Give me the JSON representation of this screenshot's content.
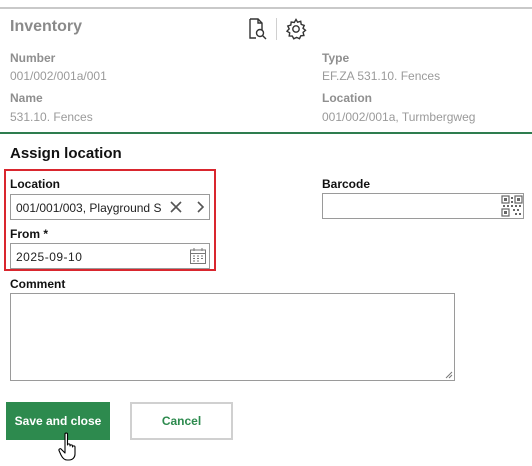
{
  "inventory": {
    "title": "Inventory",
    "number_label": "Number",
    "number_value": "001/002/001a/001",
    "type_label": "Type",
    "type_value": "EF.ZA 531.10. Fences",
    "name_label": "Name",
    "name_value": "531.10. Fences",
    "location_label": "Location",
    "location_value": "001/002/001a, Turmbergweg",
    "icons": [
      "document-search-icon",
      "gear-icon"
    ]
  },
  "assign": {
    "title": "Assign location",
    "location_label": "Location",
    "location_value": "001/001/003, Playground S",
    "from_label": "From *",
    "from_value": "2025-09-10",
    "barcode_label": "Barcode",
    "barcode_value": "",
    "comment_label": "Comment",
    "comment_value": ""
  },
  "actions": {
    "save_label": "Save and close",
    "cancel_label": "Cancel"
  },
  "colors": {
    "accent_green": "#2d8a4e",
    "highlight_red": "#d9262e",
    "divider_green": "#2e7d4f"
  }
}
